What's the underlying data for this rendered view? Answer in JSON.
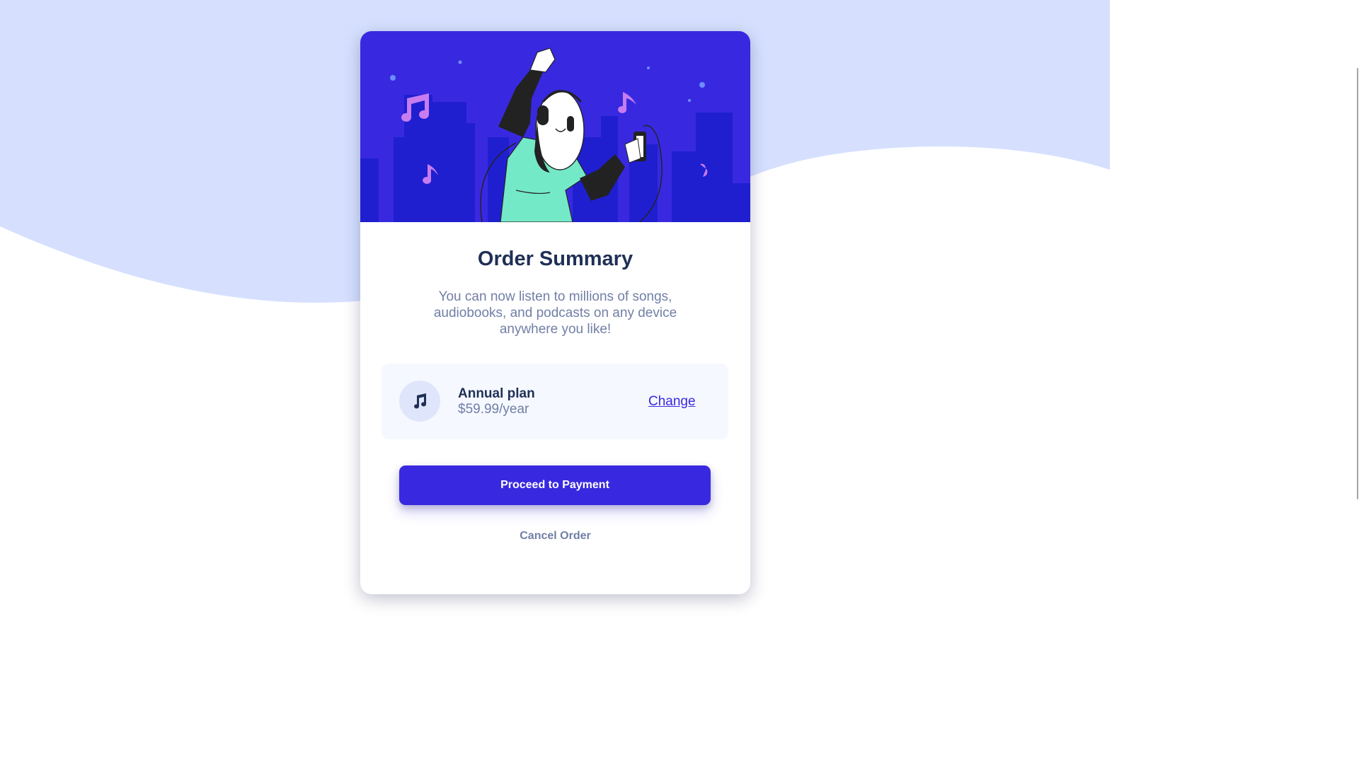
{
  "card": {
    "title": "Order Summary",
    "description": "You can now listen to millions of songs, audiobooks, and podcasts on any device anywhere you like!"
  },
  "plan": {
    "name": "Annual plan",
    "price": "$59.99/year",
    "change_label": "Change",
    "icon": "music-note-icon"
  },
  "actions": {
    "proceed_label": "Proceed to Payment",
    "cancel_label": "Cancel Order"
  },
  "colors": {
    "page_background_wave": "#d6e0fe",
    "hero_background": "#3829e0",
    "primary_button": "#3829e0",
    "title_text": "#1f2f56",
    "muted_text": "#717fa6",
    "plan_box": "#f5f8ff"
  }
}
